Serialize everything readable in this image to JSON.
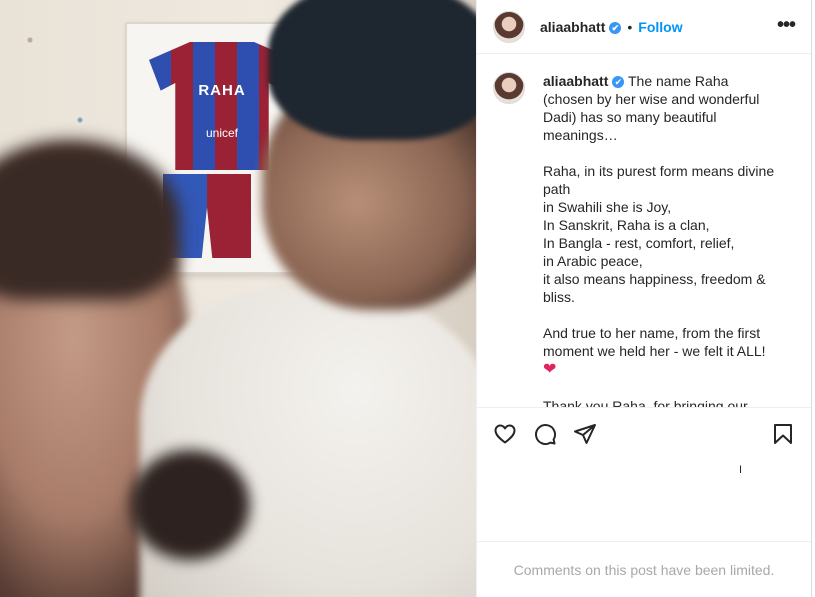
{
  "post": {
    "jersey_name": "RAHA",
    "jersey_sponsor": "unicef"
  },
  "header": {
    "username": "aliaabhatt",
    "verified_mark": "✔",
    "separator": "•",
    "follow_label": "Follow",
    "more_label": "•••"
  },
  "caption": {
    "username": "aliaabhatt",
    "verified_mark": "✔",
    "text": " The name Raha (chosen by her wise and wonderful Dadi) has so many beautiful meanings…\n\nRaha, in its purest form means divine path\nin Swahili she is Joy,\nIn Sanskrit, Raha is a clan,\nIn Bangla - rest, comfort, relief,\nin Arabic peace,\nit also means happiness, freedom & bliss.\n\nAnd true to her name, from the first moment we held her - we felt it ALL!\n",
    "heart": "❤",
    "text_after": "\n\nThank you Raha, for bringing our family to life it feels as though"
  },
  "actions": {
    "like_icon": "heart-icon",
    "comment_icon": "comment-icon",
    "share_icon": "share-icon",
    "save_icon": "bookmark-icon",
    "cursor_glyph": "I"
  },
  "footer": {
    "comments_limited": "Comments on this post have been limited."
  },
  "colors": {
    "follow": "#0095f6",
    "verified": "#3897f0",
    "muted": "#a8a8a8"
  }
}
